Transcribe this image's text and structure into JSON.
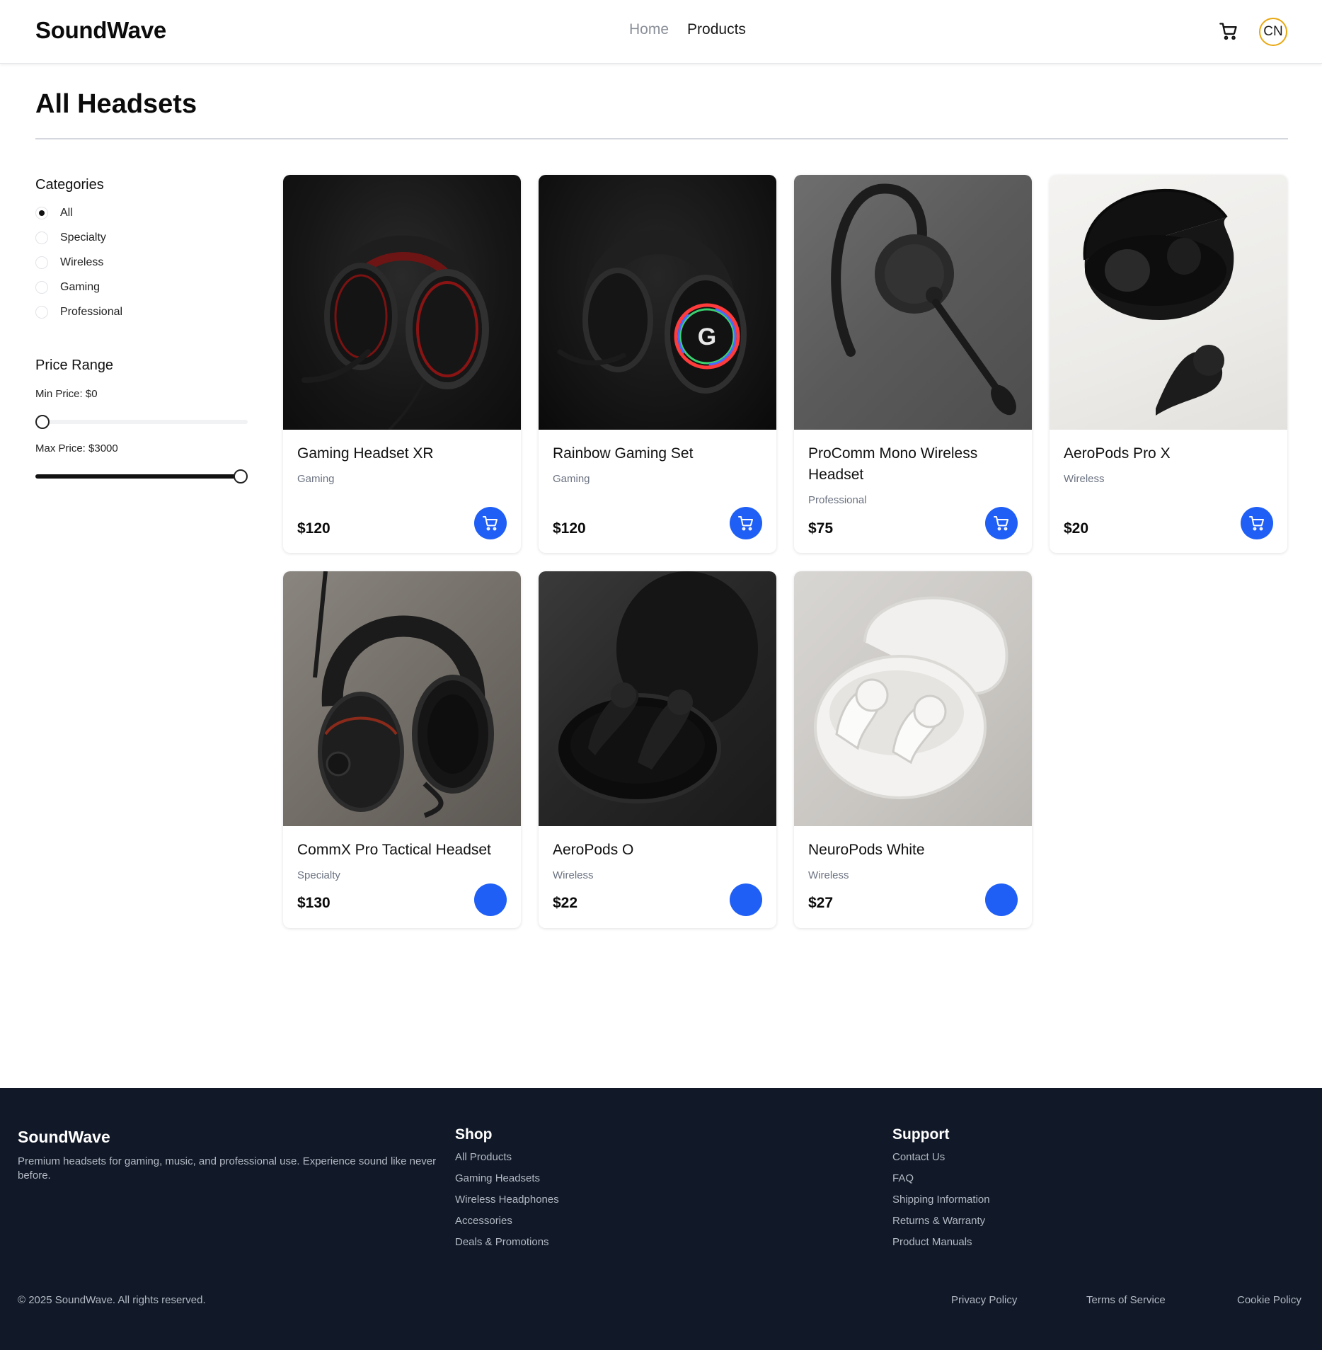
{
  "header": {
    "logo": "SoundWave",
    "nav": {
      "home": "Home",
      "products": "Products"
    },
    "avatar_initials": "CN"
  },
  "page": {
    "title": "All Headsets"
  },
  "filters": {
    "categories_heading": "Categories",
    "categories": [
      {
        "label": "All",
        "selected": true
      },
      {
        "label": "Specialty",
        "selected": false
      },
      {
        "label": "Wireless",
        "selected": false
      },
      {
        "label": "Gaming",
        "selected": false
      },
      {
        "label": "Professional",
        "selected": false
      }
    ],
    "price_heading": "Price Range",
    "min_label": "Min Price: $0",
    "max_label": "Max Price: $3000",
    "min_value": 0,
    "max_value": 3000,
    "range_max": 3000
  },
  "products": [
    {
      "name": "Gaming Headset XR",
      "category": "Gaming",
      "price": "$120",
      "image": "over-ear-headset-red-accent"
    },
    {
      "name": "Rainbow Gaming Set",
      "category": "Gaming",
      "price": "$120",
      "image": "over-ear-headset-rgb-ring"
    },
    {
      "name": "ProComm Mono Wireless Headset",
      "category": "Professional",
      "price": "$75",
      "image": "mono-earhook-headset"
    },
    {
      "name": "AeroPods Pro X",
      "category": "Wireless",
      "price": "$20",
      "image": "black-earbuds-case-light"
    },
    {
      "name": "CommX Pro Tactical Headset",
      "category": "Specialty",
      "price": "$130",
      "image": "tactical-headset"
    },
    {
      "name": "AeroPods O",
      "category": "Wireless",
      "price": "$22",
      "image": "black-earbuds-case-dark"
    },
    {
      "name": "NeuroPods White",
      "category": "Wireless",
      "price": "$27",
      "image": "white-earbuds-case"
    }
  ],
  "footer": {
    "brand": "SoundWave",
    "description": "Premium headsets for gaming, music, and professional use. Experience sound like never before.",
    "shop_title": "Shop",
    "shop_links": [
      "All Products",
      "Gaming Headsets",
      "Wireless Headphones",
      "Accessories",
      "Deals & Promotions"
    ],
    "support_title": "Support",
    "support_links": [
      "Contact Us",
      "FAQ",
      "Shipping Information",
      "Returns & Warranty",
      "Product Manuals"
    ],
    "copyright": "© 2025 SoundWave. All rights reserved.",
    "legal_links": [
      "Privacy Policy",
      "Terms of Service",
      "Cookie Policy"
    ]
  },
  "colors": {
    "accent_blue": "#1f5ff5",
    "footer_bg": "#111827",
    "avatar_ring": "#e9a811"
  }
}
